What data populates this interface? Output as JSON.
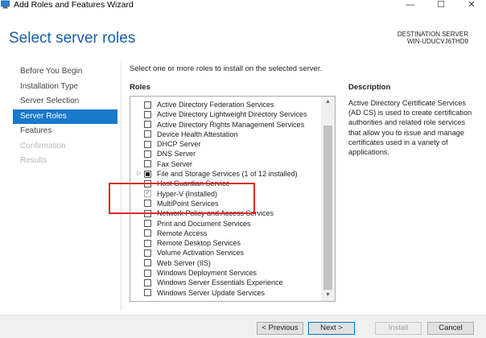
{
  "window": {
    "title": "Add Roles and Features Wizard",
    "minimize_glyph": "—",
    "maximize_glyph": "☐",
    "close_glyph": "✕"
  },
  "header": {
    "page_title": "Select server roles",
    "destination_label": "DESTINATION SERVER",
    "destination_name": "WIN-UDUCVJ6THD9"
  },
  "nav": {
    "items": [
      {
        "label": "Before You Begin",
        "state": "normal"
      },
      {
        "label": "Installation Type",
        "state": "normal"
      },
      {
        "label": "Server Selection",
        "state": "normal"
      },
      {
        "label": "Server Roles",
        "state": "active"
      },
      {
        "label": "Features",
        "state": "normal"
      },
      {
        "label": "Confirmation",
        "state": "disabled"
      },
      {
        "label": "Results",
        "state": "disabled"
      }
    ]
  },
  "main": {
    "intro": "Select one or more roles to install on the selected server.",
    "roles_heading": "Roles",
    "description_heading": "Description",
    "description_text": "Active Directory Certificate Services (AD CS) is used to create certification authorities and related role services that allow you to issue and manage certificates used in a variety of applications.",
    "roles": [
      {
        "label": "Active Directory Federation Services",
        "state": "unchecked",
        "expandable": false
      },
      {
        "label": "Active Directory Lightweight Directory Services",
        "state": "unchecked",
        "expandable": false
      },
      {
        "label": "Active Directory Rights Management Services",
        "state": "unchecked",
        "expandable": false
      },
      {
        "label": "Device Health Attestation",
        "state": "unchecked",
        "expandable": false
      },
      {
        "label": "DHCP Server",
        "state": "unchecked",
        "expandable": false
      },
      {
        "label": "DNS Server",
        "state": "unchecked",
        "expandable": false
      },
      {
        "label": "Fax Server",
        "state": "unchecked",
        "expandable": false
      },
      {
        "label": "File and Storage Services (1 of 12 installed)",
        "state": "partial",
        "expandable": true
      },
      {
        "label": "Host Guardian Service",
        "state": "unchecked",
        "expandable": false
      },
      {
        "label": "Hyper-V (Installed)",
        "state": "checked",
        "expandable": false
      },
      {
        "label": "MultiPoint Services",
        "state": "unchecked",
        "expandable": false
      },
      {
        "label": "Network Policy and Access Services",
        "state": "unchecked",
        "expandable": false
      },
      {
        "label": "Print and Document Services",
        "state": "unchecked",
        "expandable": false
      },
      {
        "label": "Remote Access",
        "state": "unchecked",
        "expandable": false
      },
      {
        "label": "Remote Desktop Services",
        "state": "unchecked",
        "expandable": false
      },
      {
        "label": "Volume Activation Services",
        "state": "unchecked",
        "expandable": false
      },
      {
        "label": "Web Server (IIS)",
        "state": "unchecked",
        "expandable": false
      },
      {
        "label": "Windows Deployment Services",
        "state": "unchecked",
        "expandable": false
      },
      {
        "label": "Windows Server Essentials Experience",
        "state": "unchecked",
        "expandable": false
      },
      {
        "label": "Windows Server Update Services",
        "state": "unchecked",
        "expandable": false
      }
    ]
  },
  "footer": {
    "previous_label": "< Previous",
    "next_label": "Next >",
    "install_label": "Install",
    "cancel_label": "Cancel"
  },
  "colors": {
    "accent": "#1979ca",
    "title": "#1a5ea8",
    "annotation": "#e02828"
  }
}
